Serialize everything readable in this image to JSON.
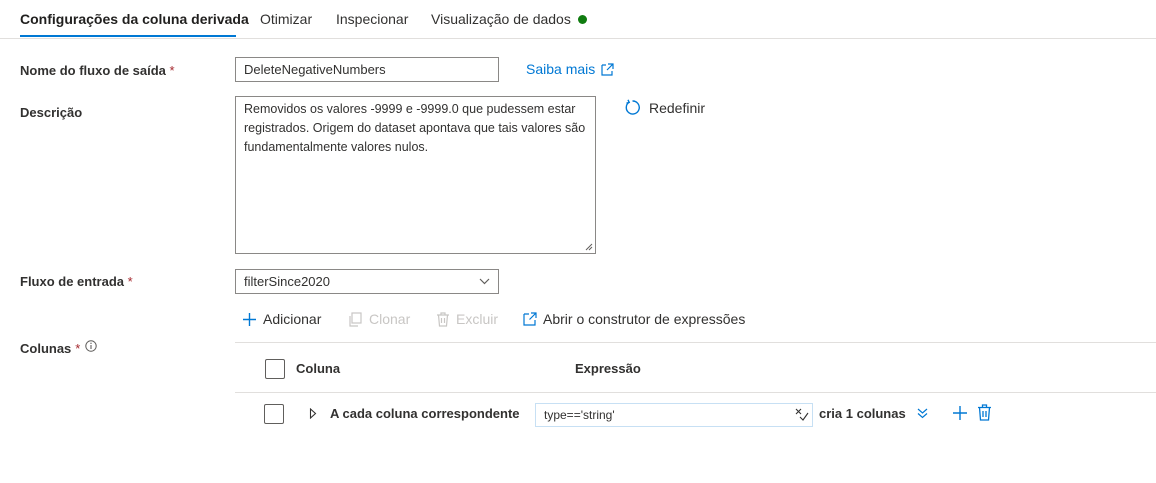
{
  "tabs": [
    {
      "label": "Configurações da coluna derivada",
      "active": true
    },
    {
      "label": "Otimizar"
    },
    {
      "label": "Inspecionar"
    },
    {
      "label": "Visualização de dados",
      "status_color": "#107c10"
    }
  ],
  "form": {
    "output_stream": {
      "label": "Nome do fluxo de saída",
      "required_mark": "*",
      "value": "DeleteNegativeNumbers"
    },
    "learn_more": {
      "label": "Saiba mais",
      "icon": "external-link-icon"
    },
    "description": {
      "label": "Descrição",
      "value": "Removidos os valores -9999 e -9999.0 que pudessem estar registrados. Origem do dataset apontava que tais valores são fundamentalmente valores nulos."
    },
    "reset": {
      "label": "Redefinir",
      "icon": "refresh-icon"
    },
    "input_stream": {
      "label": "Fluxo de entrada",
      "required_mark": "*",
      "value": "filterSince2020"
    },
    "columns": {
      "label": "Colunas",
      "required_mark": "*",
      "info_icon": "info-icon"
    }
  },
  "toolbar": {
    "add": "Adicionar",
    "clone": "Clonar",
    "delete": "Excluir",
    "expression_builder": "Abrir o construtor de expressões"
  },
  "grid": {
    "headers": {
      "column": "Coluna",
      "expression": "Expressão"
    },
    "rows": [
      {
        "column": "A cada coluna correspondente",
        "expression": "type=='string'",
        "creates": "cria 1 colunas"
      }
    ]
  },
  "colors": {
    "accent": "#0078d4",
    "required": "#a4262c",
    "status_ok": "#107c10"
  }
}
